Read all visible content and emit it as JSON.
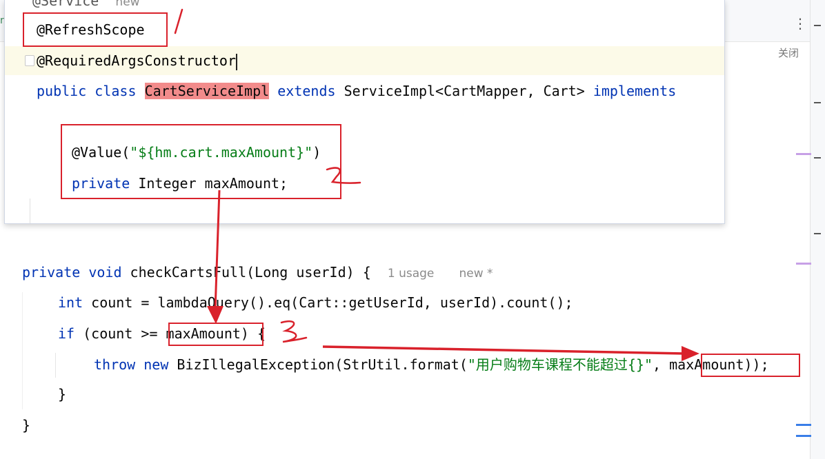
{
  "editor": {
    "popup": {
      "service_line": "@Service",
      "service_hint": "new",
      "refresh_scope": "@RefreshScope",
      "required_args": "@RequiredArgsConstructor",
      "class_decl": {
        "public": "public",
        "class": "class",
        "class_name": "CartServiceImpl",
        "extends": "extends",
        "super": "ServiceImpl<CartMapper, Cart>",
        "implements": "implements"
      },
      "value_annotation_prefix": "@Value(",
      "value_annotation_string": "\"${hm.cart.maxAmount}\"",
      "value_annotation_suffix": ")",
      "field_private": "private",
      "field_decl": " Integer maxAmount;"
    },
    "method": {
      "private": "private",
      "void": "void",
      "signature": " checkCartsFull(Long userId) {",
      "usage_hint": "1 usage",
      "new_hint": "new *",
      "line1_kw": "int",
      "line1_rest": " count = lambdaQuery().eq(Cart::getUserId, userId).count();",
      "line2_kw": "if",
      "line2_pre": " (count >= ",
      "line2_var": "maxAmount",
      "line2_post": ") {",
      "line3_throw": "throw",
      "line3_new": "new",
      "line3_mid": " BizIllegalException(StrUtil.format(",
      "line3_str": "\"用户购物车课程不能超过{}\"",
      "line3_comma": ", ",
      "line3_var": "maxAmount",
      "line3_end": "));",
      "close_inner": "}",
      "close_outer": "}"
    }
  },
  "chrome": {
    "more_icon": "⋮",
    "close_label": "关闭",
    "left_tab_fragment": "rt"
  },
  "annotations": {
    "marks": [
      "/",
      "2",
      "3"
    ],
    "color": "#d9212b"
  },
  "colors": {
    "keyword": "#0033b3",
    "string": "#067d17",
    "class_highlight": "#f28b8b",
    "current_line": "#fcfae8",
    "hint": "#8a8a8a"
  }
}
